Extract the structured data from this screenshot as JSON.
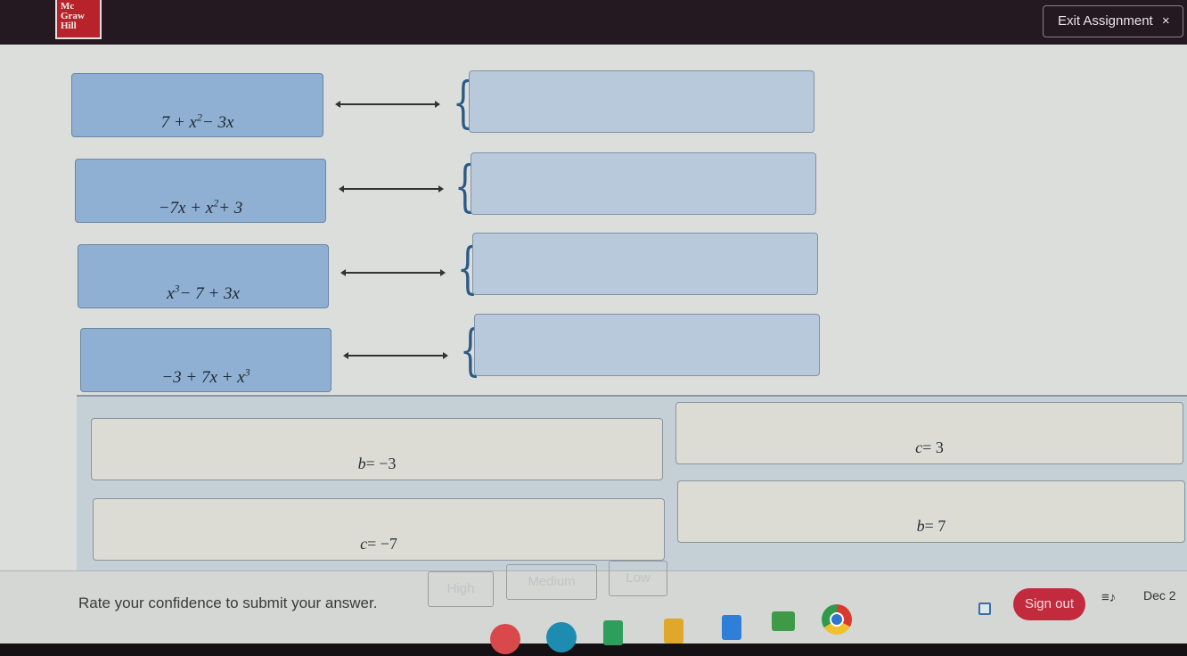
{
  "header": {
    "logo_text": "Mc Graw Hill",
    "exit_button_label": "Exit Assignment",
    "exit_icon": "×"
  },
  "matching": {
    "terms": [
      {
        "base": "7 + x",
        "sup": "2",
        "tail": " − 3x",
        "full": "7 + x^2 - 3x"
      },
      {
        "base": "−7x + x",
        "sup": "2",
        "tail": " + 3",
        "full": "-7x + x^2 + 3"
      },
      {
        "base": "x",
        "sup": "3",
        "tail": " − 7 + 3x",
        "full": "x^3 - 7 + 3x"
      },
      {
        "base": "−3 + 7x + x",
        "sup": "3",
        "tail": "",
        "full": "-3 + 7x + x^3"
      }
    ],
    "dropzones": [
      "",
      "",
      "",
      ""
    ]
  },
  "answer_bank": {
    "tiles": [
      {
        "var": "b",
        "value": " = −3"
      },
      {
        "var": "c",
        "value": " = 3"
      },
      {
        "var": "c",
        "value": " = −7"
      },
      {
        "var": "b",
        "value": " = 7"
      }
    ]
  },
  "confidence": {
    "prompt": "Rate your confidence to submit your answer.",
    "options": [
      "High",
      "Medium",
      "Low"
    ]
  },
  "shelf": {
    "apps": [
      "palette-app",
      "screencast-app",
      "google-sheets",
      "google-slides",
      "google-docs",
      "google-classroom",
      "chrome"
    ],
    "sign_out_label": "Sign out",
    "date": "Dec 2"
  }
}
